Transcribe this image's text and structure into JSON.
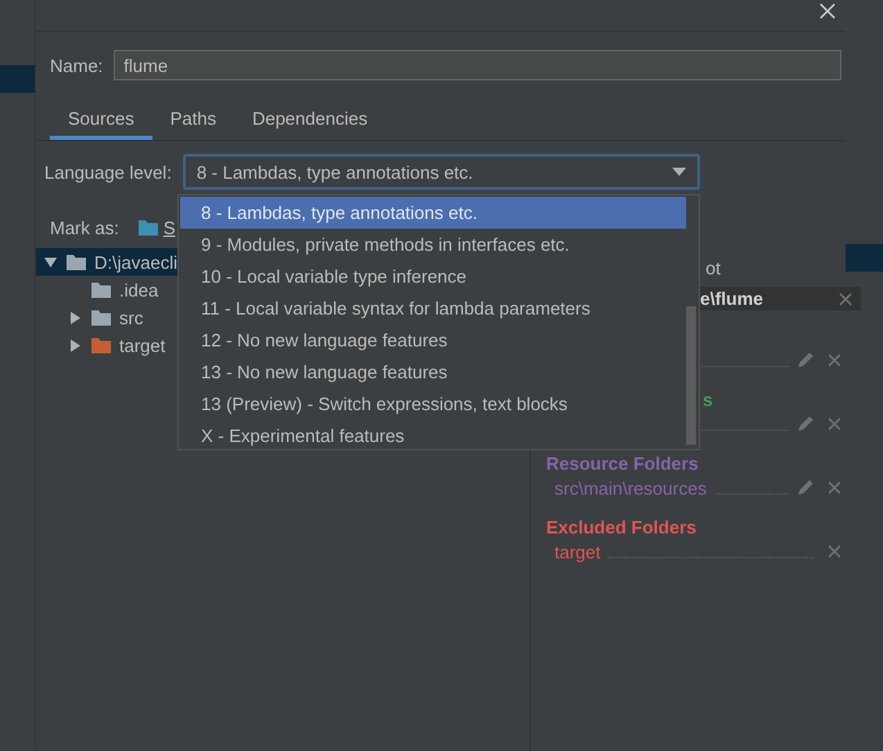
{
  "name_field": {
    "label": "Name:",
    "value": "flume"
  },
  "tabs": [
    {
      "label": "Sources",
      "selected": true
    },
    {
      "label": "Paths",
      "selected": false
    },
    {
      "label": "Dependencies",
      "selected": false
    }
  ],
  "language_level": {
    "label": "Language level:",
    "value": "8 - Lambdas, type annotations etc.",
    "expanded": true,
    "options": [
      {
        "label": "8 - Lambdas, type annotations etc.",
        "selected": true
      },
      {
        "label": "9 - Modules, private methods in interfaces etc.",
        "selected": false
      },
      {
        "label": "10 - Local variable type inference",
        "selected": false
      },
      {
        "label": "11 - Local variable syntax for lambda parameters",
        "selected": false
      },
      {
        "label": "12 - No new language features",
        "selected": false
      },
      {
        "label": "13 - No new language features",
        "selected": false
      },
      {
        "label": "13 (Preview) - Switch expressions, text blocks",
        "selected": false
      },
      {
        "label": "X - Experimental features",
        "selected": false
      }
    ]
  },
  "mark_as": {
    "label": "Mark as:",
    "source_button": "S"
  },
  "tree": [
    {
      "label": "D:\\javaecli",
      "expanded": true,
      "selected": true,
      "children": [
        {
          "label": ".idea",
          "kind": "plain",
          "selected": false
        },
        {
          "label": "src",
          "kind": "plain",
          "expanded": false,
          "selected": false
        },
        {
          "label": "target",
          "kind": "excluded",
          "expanded": false,
          "selected": false
        }
      ]
    }
  ],
  "roots_panel": {
    "add_root": "ot",
    "root_path": "e\\flume",
    "groups": [
      {
        "kind": "source",
        "entries": [
          {
            "editable": true
          }
        ]
      },
      {
        "kind": "test",
        "title": "s",
        "entries": [
          {
            "editable": true
          }
        ]
      },
      {
        "kind": "resource",
        "title": "Resource Folders",
        "entries": [
          {
            "path": "src\\main\\resources",
            "editable": true
          }
        ]
      },
      {
        "kind": "excluded",
        "title": "Excluded Folders",
        "entries": [
          {
            "path": "target",
            "editable": false
          }
        ]
      }
    ]
  }
}
